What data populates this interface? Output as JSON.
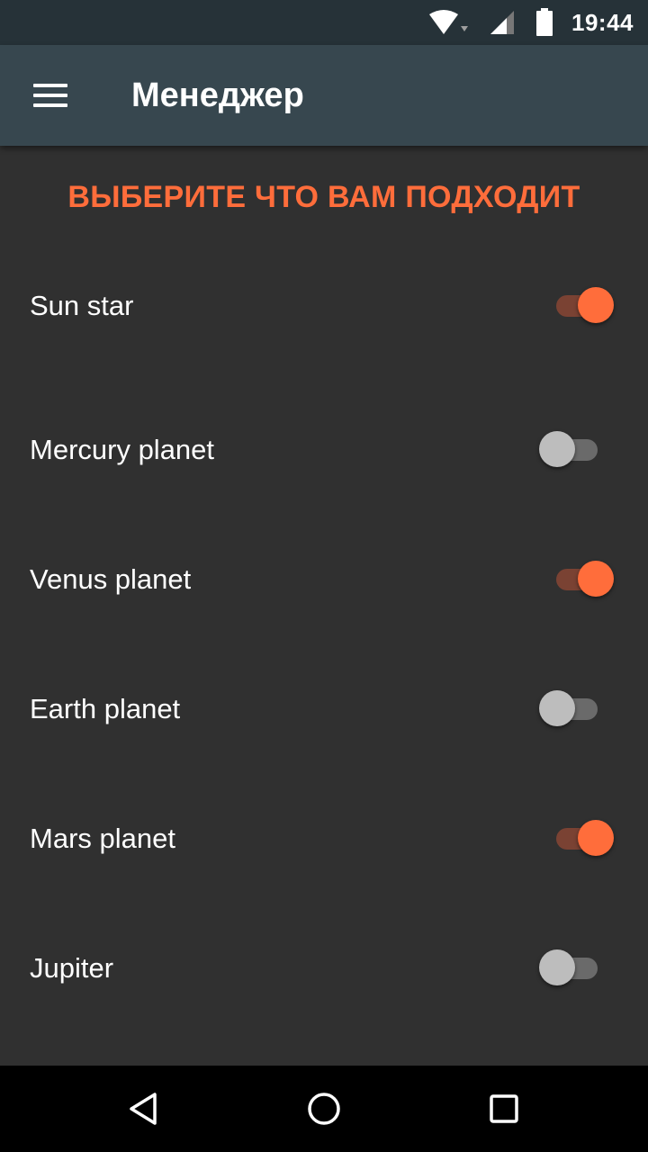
{
  "status_bar": {
    "time": "19:44",
    "icons": [
      "wifi-icon",
      "signal-icon",
      "battery-icon"
    ]
  },
  "app_bar": {
    "title": "Менеджер",
    "menu_icon": "hamburger-menu-icon"
  },
  "main": {
    "heading": "ВЫБЕРИТЕ ЧТО ВАМ ПОДХОДИТ",
    "items": [
      {
        "label": "Sun star",
        "checked": true
      },
      {
        "label": "Mercury planet",
        "checked": false
      },
      {
        "label": "Venus planet",
        "checked": true
      },
      {
        "label": "Earth planet",
        "checked": false
      },
      {
        "label": "Mars planet",
        "checked": true
      },
      {
        "label": "Jupiter",
        "checked": false
      }
    ]
  },
  "nav_bar": {
    "icons": [
      "back-icon",
      "home-icon",
      "recents-icon"
    ]
  },
  "colors": {
    "accent": "#ff6d3b",
    "app_bar": "#37474f",
    "status_bar": "#263238",
    "background": "#303030"
  }
}
